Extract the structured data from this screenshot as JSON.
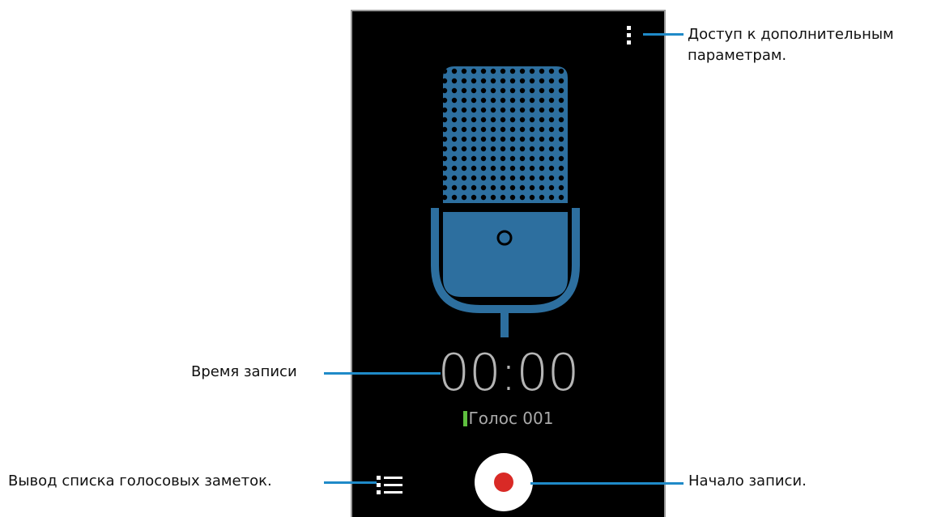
{
  "recorder": {
    "timer": "00:00",
    "filename": "Голос 001"
  },
  "callouts": {
    "menu_line1": "Доступ к дополнительным",
    "menu_line2": "параметрам.",
    "time": "Время записи",
    "list": "Вывод списка голосовых заметок.",
    "record": "Начало записи."
  },
  "icons": {
    "menu": "more-vertical-icon",
    "microphone": "microphone-icon",
    "list": "list-icon",
    "record": "record-icon"
  },
  "colors": {
    "screen_background": "#000000",
    "microphone": "#2d6f9f",
    "timer_text": "#b5b5b5",
    "filename_marker": "#5fbf3f",
    "record_dot": "#d92a26",
    "leader_line": "#1f8ac8"
  }
}
